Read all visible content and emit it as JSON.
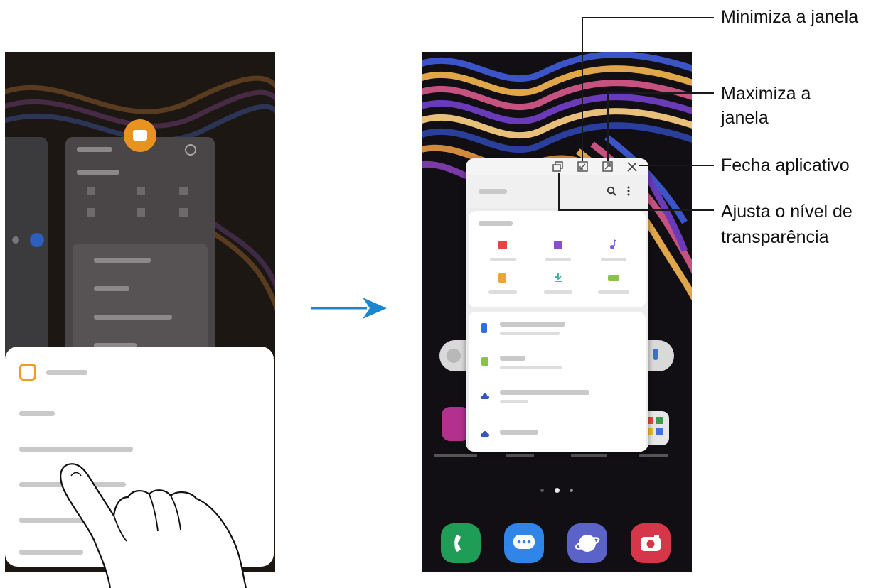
{
  "callouts": {
    "minimize": "Minimiza a janela",
    "maximize_line1": "Maximiza a",
    "maximize_line2": "janela",
    "close": "Fecha aplicativo",
    "transparency_line1": "Ajusta o nível de",
    "transparency_line2": "transparência"
  },
  "colors": {
    "accent_arrow": "#1a86d0",
    "callout_line": "#1a1a1a",
    "phone_dark": "#151218",
    "files_orange": "#f19a23",
    "phone_app_green": "#1f9c55",
    "messages_blue": "#2f86e8",
    "internet_purple": "#5b63c9",
    "camera_red": "#d63649"
  },
  "icons": {
    "left_menu_app_icon": "my-files-icon",
    "popup_search": "search-icon",
    "popup_more": "more-vert-icon",
    "toolbar_transparency": "transparency-icon",
    "toolbar_minimize": "minimize-icon",
    "toolbar_maximize": "maximize-icon",
    "toolbar_close": "close-icon",
    "dock": [
      "phone-icon",
      "messages-icon",
      "internet-icon",
      "camera-icon"
    ],
    "big_arrow": "arrow-right-icon"
  }
}
